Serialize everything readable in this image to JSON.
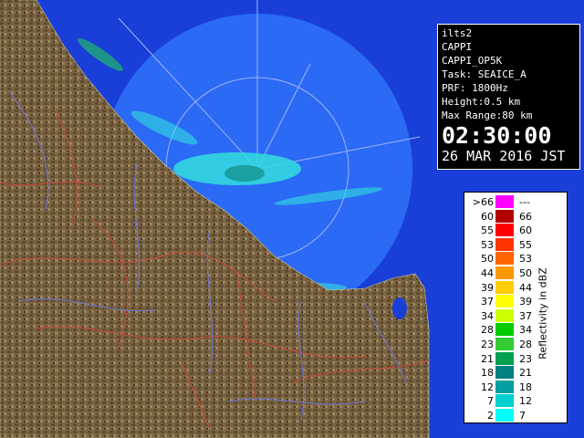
{
  "panel": {
    "station": "ilts2",
    "product": "CAPPI",
    "product_code": "CAPPI_OP5K",
    "task": "Task: SEAICE_A",
    "prf": "PRF: 1800Hz",
    "height": "Height:0.5 km",
    "max_range": "Max Range:80 km",
    "time": "02:30:00",
    "date": "26 MAR 2016 JST"
  },
  "legend": {
    "title": "Reflectivity in dBZ",
    "rows": [
      {
        "lo": ">66",
        "hi": "---",
        "color": "#ff00ff"
      },
      {
        "lo": "60",
        "hi": "66",
        "color": "#b00000"
      },
      {
        "lo": "55",
        "hi": "60",
        "color": "#ff0000"
      },
      {
        "lo": "53",
        "hi": "55",
        "color": "#ff3300"
      },
      {
        "lo": "50",
        "hi": "53",
        "color": "#ff6600"
      },
      {
        "lo": "44",
        "hi": "50",
        "color": "#ff9900"
      },
      {
        "lo": "39",
        "hi": "44",
        "color": "#ffcc00"
      },
      {
        "lo": "37",
        "hi": "39",
        "color": "#ffff00"
      },
      {
        "lo": "34",
        "hi": "37",
        "color": "#ccff00"
      },
      {
        "lo": "28",
        "hi": "34",
        "color": "#00cc00"
      },
      {
        "lo": "23",
        "hi": "28",
        "color": "#33cc33"
      },
      {
        "lo": "21",
        "hi": "23",
        "color": "#00a050"
      },
      {
        "lo": "18",
        "hi": "21",
        "color": "#008080"
      },
      {
        "lo": "12",
        "hi": "18",
        "color": "#00a0a0"
      },
      {
        "lo": "7",
        "hi": "12",
        "color": "#00d0d0"
      },
      {
        "lo": "2",
        "hi": "7",
        "color": "#00ffff"
      }
    ]
  },
  "colors": {
    "sea": "#1a3fd8",
    "range_area": "#2a6af5",
    "land": "#7a6340",
    "rivers": "#6f78d8",
    "boundaries": "#c84a3a"
  }
}
